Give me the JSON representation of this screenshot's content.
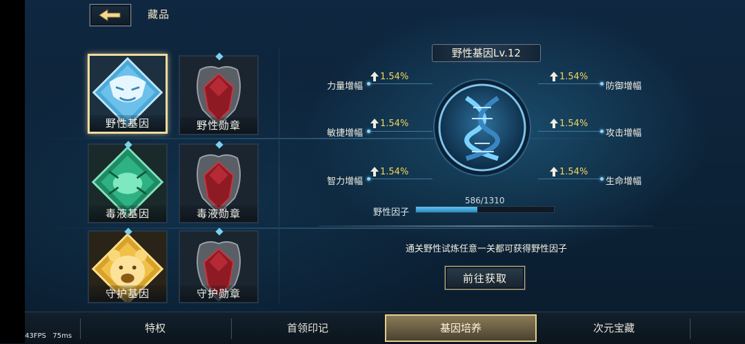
{
  "header": {
    "title": "藏品"
  },
  "cards": [
    {
      "label": "野性基因",
      "selected": true,
      "icon": "tiger-gene-icon"
    },
    {
      "label": "野性勋章",
      "selected": false,
      "icon": "red-medal-icon"
    },
    {
      "label": "毒液基因",
      "selected": false,
      "icon": "venom-gene-icon"
    },
    {
      "label": "毒液勋章",
      "selected": false,
      "icon": "red-medal-icon"
    },
    {
      "label": "守护基因",
      "selected": false,
      "icon": "bear-gene-icon"
    },
    {
      "label": "守护勋章",
      "selected": false,
      "icon": "red-medal-icon"
    }
  ],
  "gene": {
    "title": "野性基因Lv.12",
    "stats_left": [
      {
        "name": "力量增幅",
        "value": "1.54%"
      },
      {
        "name": "敏捷增幅",
        "value": "1.54%"
      },
      {
        "name": "智力增幅",
        "value": "1.54%"
      }
    ],
    "stats_right": [
      {
        "name": "防御增幅",
        "value": "1.54%"
      },
      {
        "name": "攻击增幅",
        "value": "1.54%"
      },
      {
        "name": "生命增幅",
        "value": "1.54%"
      }
    ],
    "factor_label": "野性因子",
    "factor_value": "586/1310",
    "factor_progress": 0.447,
    "hint": "通关野性试炼任意一关都可获得野性因子",
    "go_button": "前往获取"
  },
  "tabs": [
    {
      "label": "特权",
      "active": false
    },
    {
      "label": "首领印记",
      "active": false
    },
    {
      "label": "基因培养",
      "active": true
    },
    {
      "label": "次元宝藏",
      "active": false
    }
  ],
  "fps": "43FPS",
  "ms": "75ms",
  "colors": {
    "accent_gold": "#e6cf8e",
    "stat_value": "#f4d65a",
    "progress": "#5cc4ee"
  }
}
